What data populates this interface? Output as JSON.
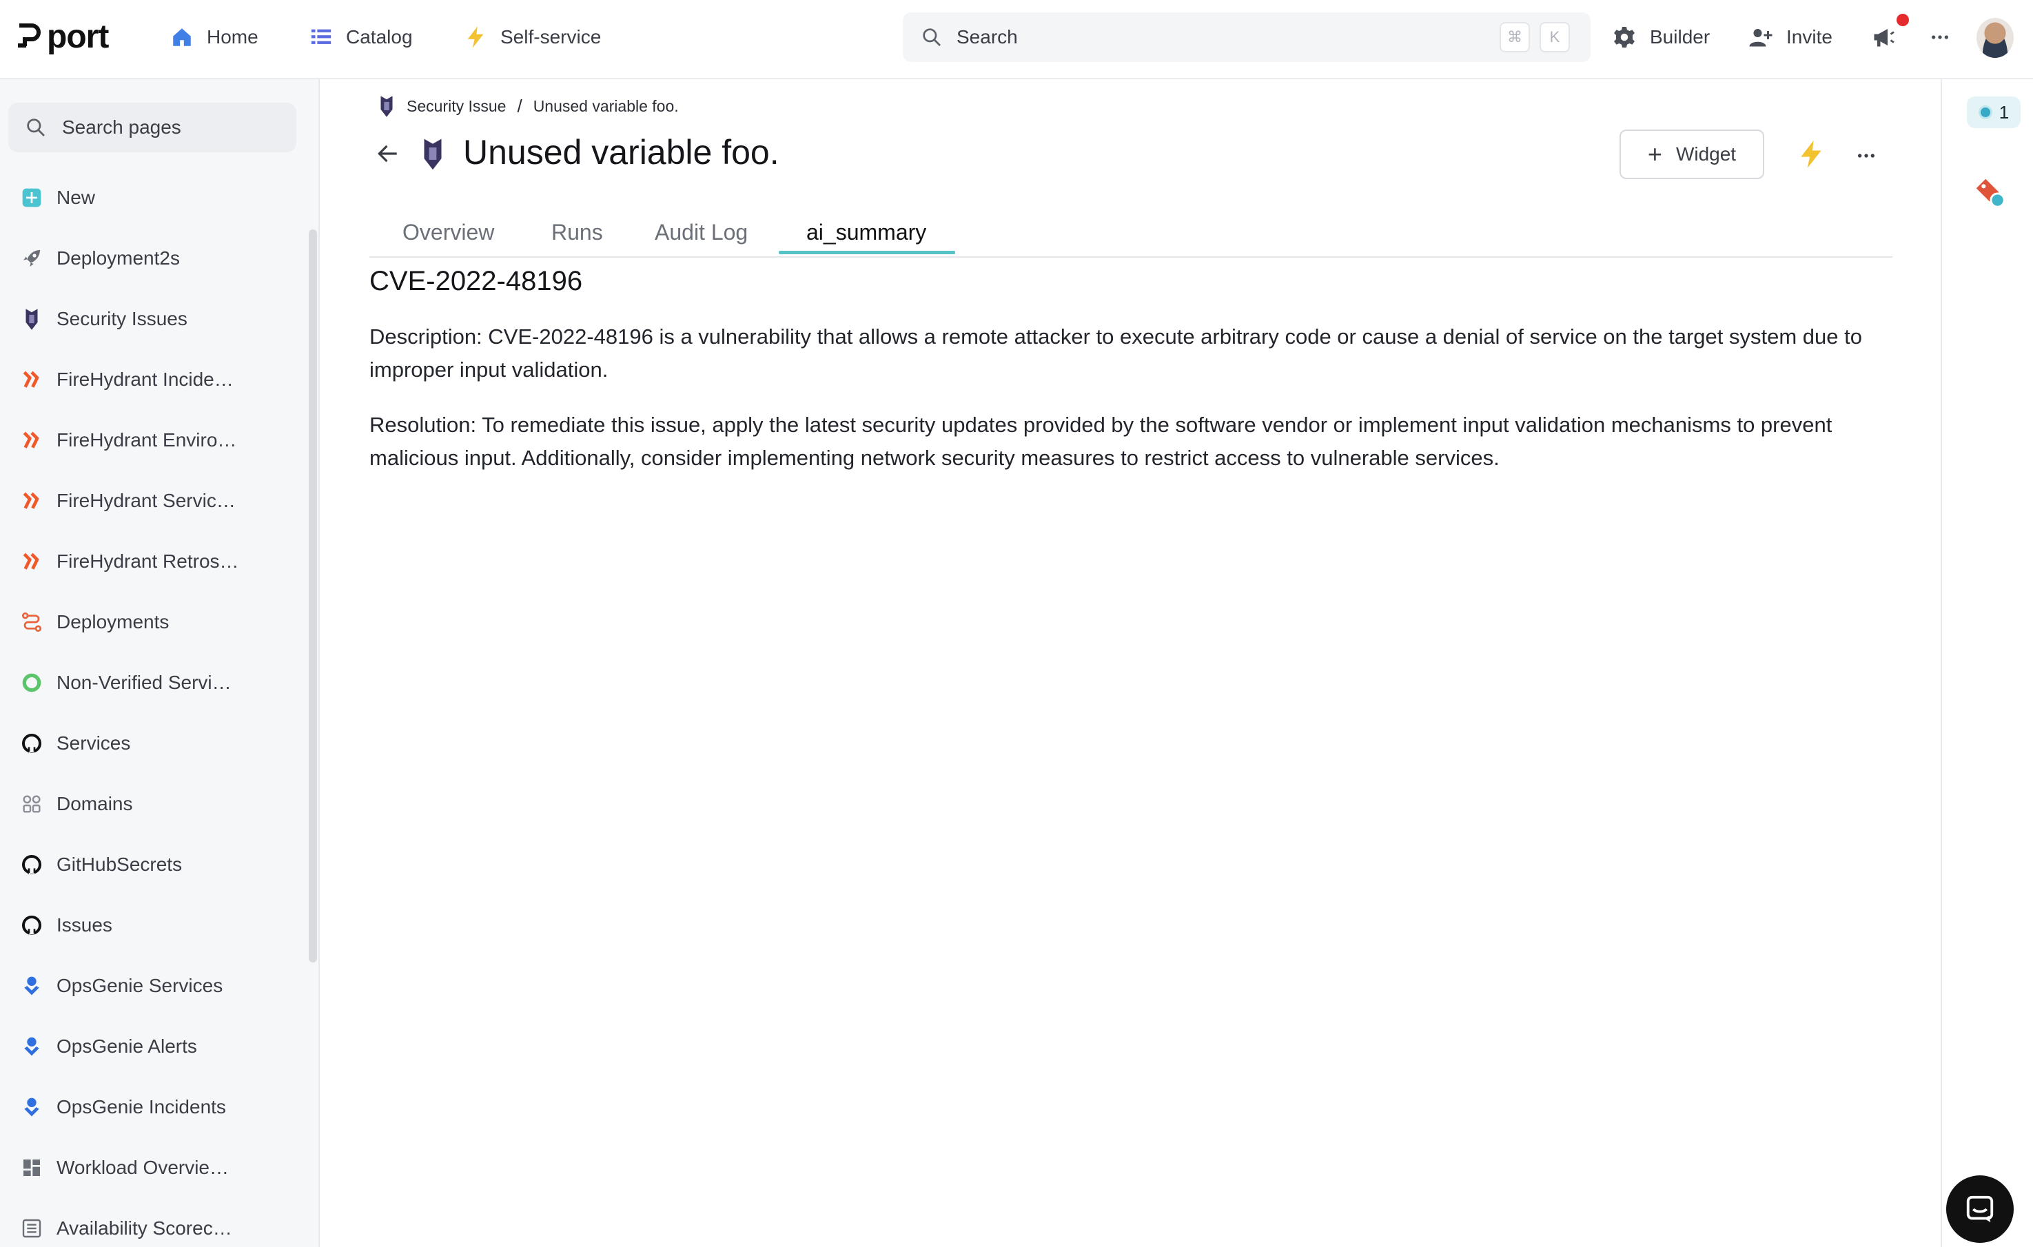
{
  "brand": {
    "name": "port"
  },
  "topnav": {
    "items": [
      {
        "label": "Home",
        "icon": "home-icon"
      },
      {
        "label": "Catalog",
        "icon": "catalog-icon"
      },
      {
        "label": "Self-service",
        "icon": "bolt-icon"
      }
    ],
    "search": {
      "placeholder": "Search",
      "shortcut_modifier": "⌘",
      "shortcut_key": "K"
    },
    "right": [
      {
        "label": "Builder",
        "icon": "gear-icon"
      },
      {
        "label": "Invite",
        "icon": "add-user-icon"
      }
    ]
  },
  "sidebar": {
    "search_placeholder": "Search pages",
    "items": [
      {
        "label": "New",
        "icon": "plus-square-icon"
      },
      {
        "label": "Deployment2s",
        "icon": "rocket-icon"
      },
      {
        "label": "Security Issues",
        "icon": "guard-icon"
      },
      {
        "label": "FireHydrant Incide…",
        "icon": "firehydrant-icon"
      },
      {
        "label": "FireHydrant Enviro…",
        "icon": "firehydrant-icon"
      },
      {
        "label": "FireHydrant Servic…",
        "icon": "firehydrant-icon"
      },
      {
        "label": "FireHydrant Retros…",
        "icon": "firehydrant-icon"
      },
      {
        "label": "Deployments",
        "icon": "route-icon"
      },
      {
        "label": "Non-Verified Servi…",
        "icon": "ring-icon"
      },
      {
        "label": "Services",
        "icon": "github-icon"
      },
      {
        "label": "Domains",
        "icon": "domains-icon"
      },
      {
        "label": "GitHubSecrets",
        "icon": "github-icon"
      },
      {
        "label": "Issues",
        "icon": "github-icon"
      },
      {
        "label": "OpsGenie Services",
        "icon": "opsgenie-icon"
      },
      {
        "label": "OpsGenie Alerts",
        "icon": "opsgenie-icon"
      },
      {
        "label": "OpsGenie Incidents",
        "icon": "opsgenie-icon"
      },
      {
        "label": "Workload Overvie…",
        "icon": "dashboard-icon"
      },
      {
        "label": "Availability Scorec…",
        "icon": "list-icon"
      }
    ]
  },
  "breadcrumb": {
    "parent": "Security Issue",
    "separator": "/",
    "current": "Unused variable foo."
  },
  "page": {
    "title": "Unused variable foo.",
    "widget_label": "Widget",
    "tabs": [
      "Overview",
      "Runs",
      "Audit Log",
      "ai_summary"
    ],
    "active_tab": "ai_summary"
  },
  "summary": {
    "heading": "CVE-2022-48196",
    "description": "Description: CVE-2022-48196 is a vulnerability that allows a remote attacker to execute arbitrary code or cause a denial of service on the target system due to improper input validation.",
    "resolution": "Resolution: To remediate this issue, apply the latest security updates provided by the software vendor or implement input validation mechanisms to prevent malicious input. Additionally, consider implementing network security measures to restrict access to vulnerable services."
  },
  "right_rail": {
    "count": "1"
  },
  "colors": {
    "accent": "#56c4c7",
    "bolt": "#f2c230",
    "notification": "#e52b2b",
    "firehydrant": "#f0592a",
    "opsgenie": "#2f6fe0"
  }
}
